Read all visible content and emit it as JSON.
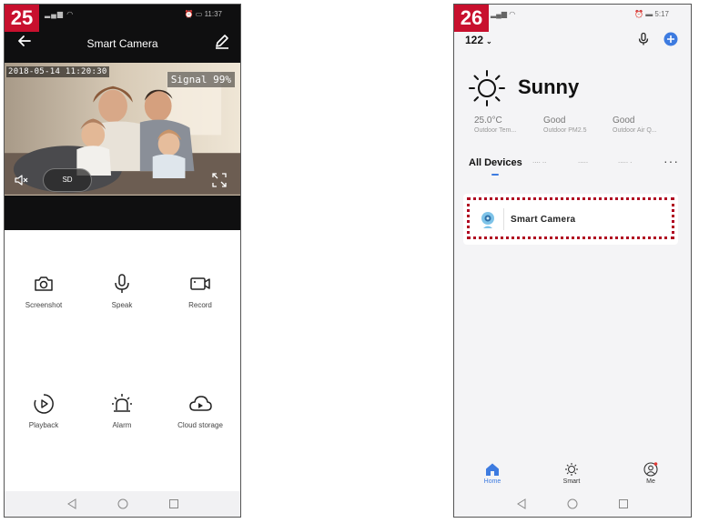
{
  "screen_left": {
    "step": "25",
    "title": "Smart Camera",
    "video": {
      "timestamp": "2018-05-14 11:20:30",
      "signal": "Signal 99%",
      "quality_label": "SD"
    },
    "controls": {
      "screenshot": "Screenshot",
      "speak": "Speak",
      "record": "Record",
      "playback": "Playback",
      "alarm": "Alarm",
      "cloud_storage": "Cloud storage"
    },
    "status_time": "11:37"
  },
  "screen_right": {
    "step": "26",
    "status_time": "5:17",
    "home_name": "122",
    "weather": {
      "condition": "Sunny",
      "metrics": [
        {
          "value": "25.0°C",
          "label": "Outdoor Tem..."
        },
        {
          "value": "Good",
          "label": "Outdoor PM2.5"
        },
        {
          "value": "Good",
          "label": "Outdoor Air Q..."
        }
      ]
    },
    "tabs": {
      "active": "All Devices",
      "more": "···"
    },
    "device": {
      "name": "Smart  Camera"
    },
    "tabbar": {
      "home": "Home",
      "smart": "Smart",
      "me": "Me"
    }
  },
  "colors": {
    "step_badge": "#c8102e",
    "accent_blue": "#3d7be0",
    "highlight_border": "#b00020",
    "header_dark": "#0f0f10"
  }
}
